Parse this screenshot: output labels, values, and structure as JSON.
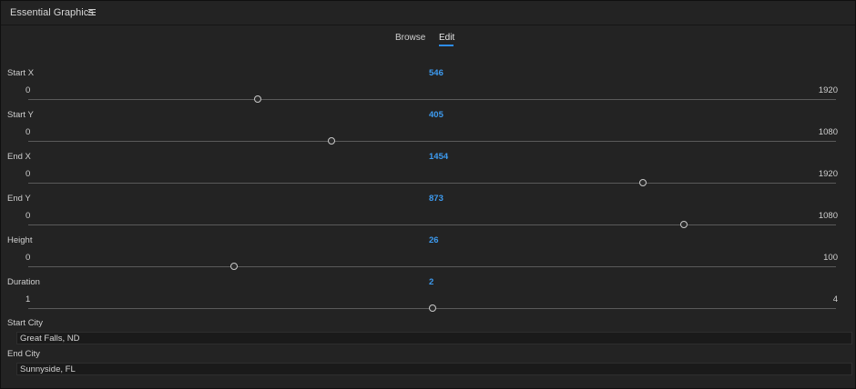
{
  "panel": {
    "title": "Essential Graphics",
    "menu_icon": "hamburger-menu-icon"
  },
  "tabs": [
    {
      "label": "Browse"
    },
    {
      "label": "Edit",
      "active": true
    }
  ],
  "accent_color": "#2d8ceb",
  "value_color": "#3d9bf0",
  "sliders": [
    {
      "label": "Start X",
      "value": "546",
      "min": "0",
      "max": "1920"
    },
    {
      "label": "Start Y",
      "value": "405",
      "min": "0",
      "max": "1080"
    },
    {
      "label": "End X",
      "value": "1454",
      "min": "0",
      "max": "1920"
    },
    {
      "label": "End Y",
      "value": "873",
      "min": "0",
      "max": "1080"
    },
    {
      "label": "Height",
      "value": "26",
      "min": "0",
      "max": "100"
    },
    {
      "label": "Duration",
      "value": "2",
      "min": "1",
      "max": "4"
    }
  ],
  "fields": [
    {
      "label": "Start City",
      "value": "Great Falls, ND"
    },
    {
      "label": "End City",
      "value": "Sunnyside, FL"
    }
  ]
}
